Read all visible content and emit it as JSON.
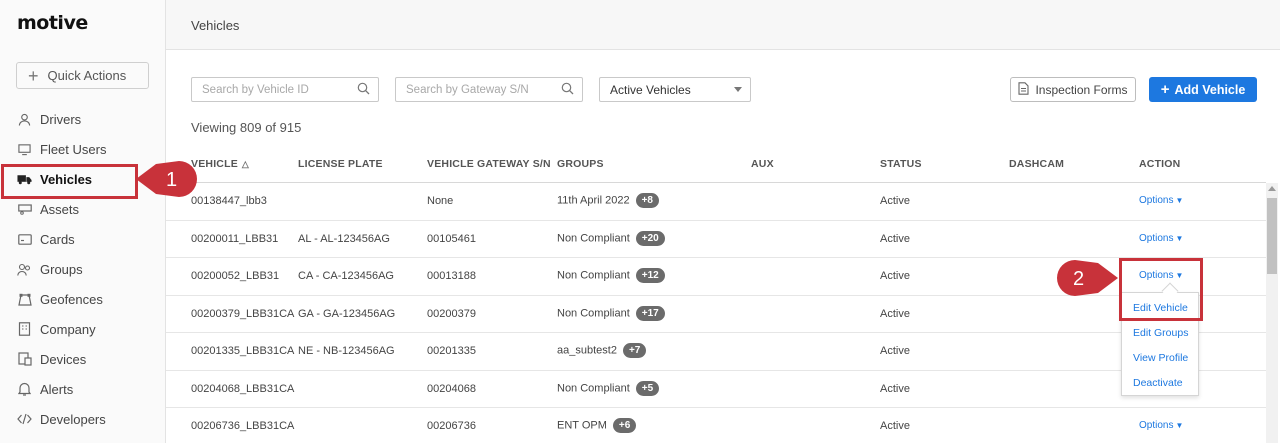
{
  "brand": {
    "logo_text": "motive"
  },
  "sidebar": {
    "quick_actions": "Quick Actions",
    "items": [
      {
        "label": "Drivers",
        "icon": "user-icon"
      },
      {
        "label": "Fleet Users",
        "icon": "monitor-icon"
      },
      {
        "label": "Vehicles",
        "icon": "truck-icon",
        "active": true
      },
      {
        "label": "Assets",
        "icon": "trailer-icon"
      },
      {
        "label": "Cards",
        "icon": "card-icon"
      },
      {
        "label": "Groups",
        "icon": "group-icon"
      },
      {
        "label": "Geofences",
        "icon": "geofence-icon"
      },
      {
        "label": "Company",
        "icon": "building-icon"
      },
      {
        "label": "Devices",
        "icon": "devices-icon"
      },
      {
        "label": "Alerts",
        "icon": "bell-icon"
      },
      {
        "label": "Developers",
        "icon": "code-icon"
      }
    ]
  },
  "header": {
    "title": "Vehicles"
  },
  "toolbar": {
    "search_vehicle_placeholder": "Search by Vehicle ID",
    "search_gateway_placeholder": "Search by Gateway S/N",
    "filter_selected": "Active Vehicles",
    "inspection_forms": "Inspection Forms",
    "add_vehicle": "Add Vehicle"
  },
  "summary": {
    "viewing": "Viewing 809 of 915"
  },
  "table": {
    "columns": [
      "VEHICLE",
      "LICENSE PLATE",
      "VEHICLE GATEWAY S/N",
      "GROUPS",
      "AUX",
      "STATUS",
      "DASHCAM",
      "ACTION"
    ],
    "rows": [
      {
        "vehicle": "00138447_lbb3",
        "plate": "",
        "gateway": "None",
        "group": "11th April 2022",
        "badge": "+8",
        "aux": "",
        "status": "Active",
        "dashcam": "",
        "action": "Options"
      },
      {
        "vehicle": "00200011_LBB31",
        "plate": "AL - AL-123456AG",
        "gateway": "00105461",
        "group": "Non Compliant",
        "badge": "+20",
        "aux": "",
        "status": "Active",
        "dashcam": "",
        "action": "Options"
      },
      {
        "vehicle": "00200052_LBB31",
        "plate": "CA - CA-123456AG",
        "gateway": "00013188",
        "group": "Non Compliant",
        "badge": "+12",
        "aux": "",
        "status": "Active",
        "dashcam": "",
        "action": "Options"
      },
      {
        "vehicle": "00200379_LBB31CA",
        "plate": "GA - GA-123456AG",
        "gateway": "00200379",
        "group": "Non Compliant",
        "badge": "+17",
        "aux": "",
        "status": "Active",
        "dashcam": "",
        "action": ""
      },
      {
        "vehicle": "00201335_LBB31CA",
        "plate": "NE - NB-123456AG",
        "gateway": "00201335",
        "group": "aa_subtest2",
        "badge": "+7",
        "aux": "",
        "status": "Active",
        "dashcam": "",
        "action": ""
      },
      {
        "vehicle": "00204068_LBB31CA",
        "plate": "",
        "gateway": "00204068",
        "group": "Non Compliant",
        "badge": "+5",
        "aux": "",
        "status": "Active",
        "dashcam": "",
        "action": ""
      },
      {
        "vehicle": "00206736_LBB31CA",
        "plate": "",
        "gateway": "00206736",
        "group": "ENT OPM",
        "badge": "+6",
        "aux": "",
        "status": "Active",
        "dashcam": "",
        "action": "Options"
      }
    ]
  },
  "action_menu": {
    "items": [
      "Edit Vehicle",
      "Edit Groups",
      "View Profile",
      "Deactivate"
    ]
  },
  "annotations": {
    "callout_1": "1",
    "callout_2": "2"
  },
  "colors": {
    "accent": "#1d78e0",
    "annotation_red": "#c8323a",
    "badge_gray": "#6b6b6b"
  }
}
